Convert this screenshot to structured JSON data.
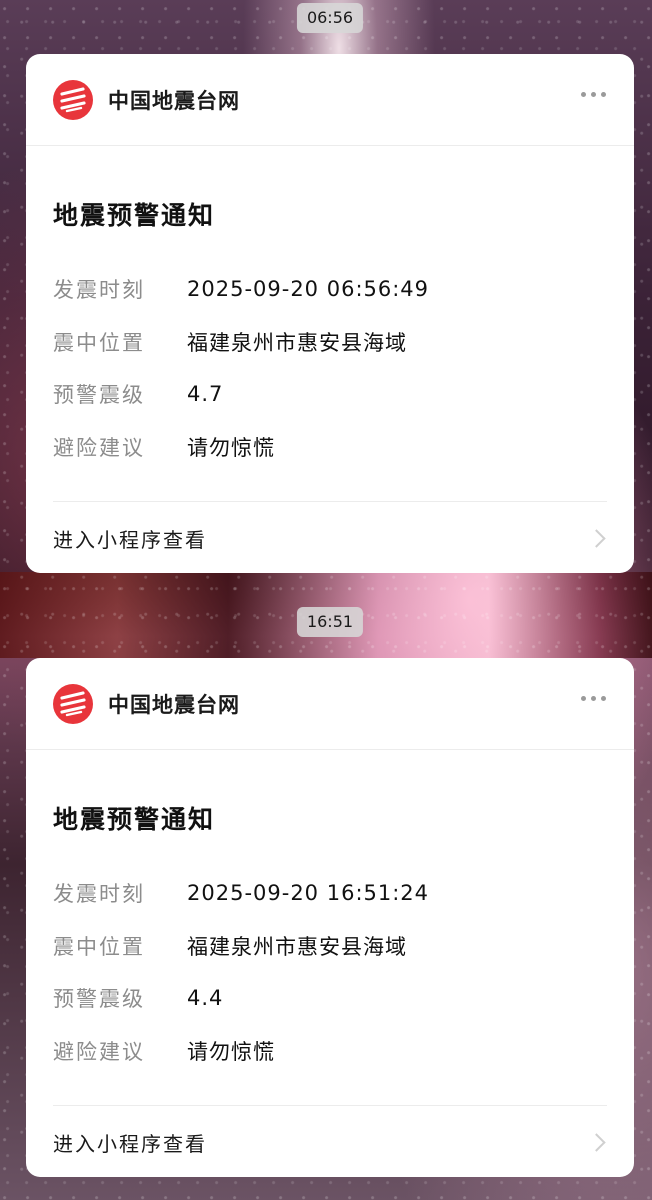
{
  "messages": [
    {
      "time": "06:56",
      "org_name": "中国地震台网",
      "title": "地震预警通知",
      "rows": [
        {
          "label": "发震时刻",
          "value": "2025-09-20 06:56:49"
        },
        {
          "label": "震中位置",
          "value": "福建泉州市惠安县海域"
        },
        {
          "label": "预警震级",
          "value": "4.7"
        },
        {
          "label": "避险建议",
          "value": "请勿惊慌"
        }
      ],
      "footer": "进入小程序查看"
    },
    {
      "time": "16:51",
      "org_name": "中国地震台网",
      "title": "地震预警通知",
      "rows": [
        {
          "label": "发震时刻",
          "value": "2025-09-20 16:51:24"
        },
        {
          "label": "震中位置",
          "value": "福建泉州市惠安县海域"
        },
        {
          "label": "预警震级",
          "value": "4.4"
        },
        {
          "label": "避险建议",
          "value": "请勿惊慌"
        }
      ],
      "footer": "进入小程序查看"
    }
  ],
  "colors": {
    "logo": "#e8353b",
    "label": "#8c8c8c",
    "text": "#111111",
    "time_pill_bg": "#d7d7d7"
  },
  "icons": {
    "logo": "seismic-logo-icon",
    "more": "more-dots-icon",
    "chevron": "chevron-right-icon"
  }
}
